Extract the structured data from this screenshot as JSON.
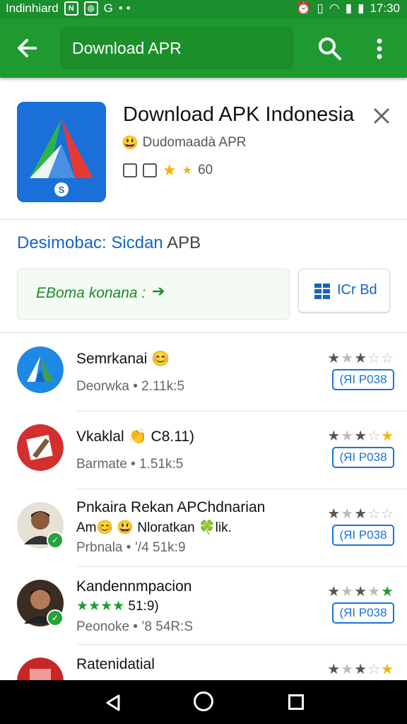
{
  "status": {
    "left_text": "Indinhiard",
    "time": "17:30"
  },
  "appbar": {
    "search_text": "Download APR"
  },
  "app": {
    "title": "Download APK Indonesia",
    "developer": "Dudomaadà APR",
    "rating": "60",
    "icon_letter": "S"
  },
  "section": {
    "title_blue": "Desimobac: Sicdan",
    "title_grey": "APB"
  },
  "offer": {
    "text": "EBoma konana :",
    "arrow": "➔"
  },
  "secondary": {
    "label": "ICr Bd"
  },
  "results": [
    {
      "name": "Semrkanai",
      "emoji": "😊",
      "sub": "Deorwka •  2.11k:5",
      "stars": [
        "on",
        "off",
        "on",
        "off",
        "off"
      ],
      "button": "(ЯI P038"
    },
    {
      "name": "Vkaklal",
      "emoji": "👏",
      "extra": "C8.11)",
      "sub": "Barmate •  1.51k:5",
      "stars": [
        "on",
        "off",
        "on",
        "off",
        "gold"
      ],
      "button": "(ЯI P038"
    },
    {
      "name": "Pnkaira Rekan APChdnarian",
      "line2": "Am😊 😃 Nloratkan 🍀lik.",
      "sub": "Prbnala • ’/4 51k:9",
      "stars": [
        "on",
        "off",
        "on",
        "off",
        "off"
      ],
      "button": "(ЯI P038"
    },
    {
      "name": "Kandennmpacion",
      "rating_line": "51:9)",
      "sub": "Peonoke • ’8 54R:S",
      "stars": [
        "on",
        "off",
        "on",
        "off",
        "green"
      ],
      "button": "(ЯI P038"
    },
    {
      "name": "Ratenidatial",
      "sub": "",
      "stars": [
        "on",
        "off",
        "on",
        "off",
        "gold"
      ],
      "button": ""
    }
  ],
  "colors": {
    "primary": "#1f9a30",
    "accent_blue": "#1a73d9",
    "star_gold": "#f4b400"
  }
}
